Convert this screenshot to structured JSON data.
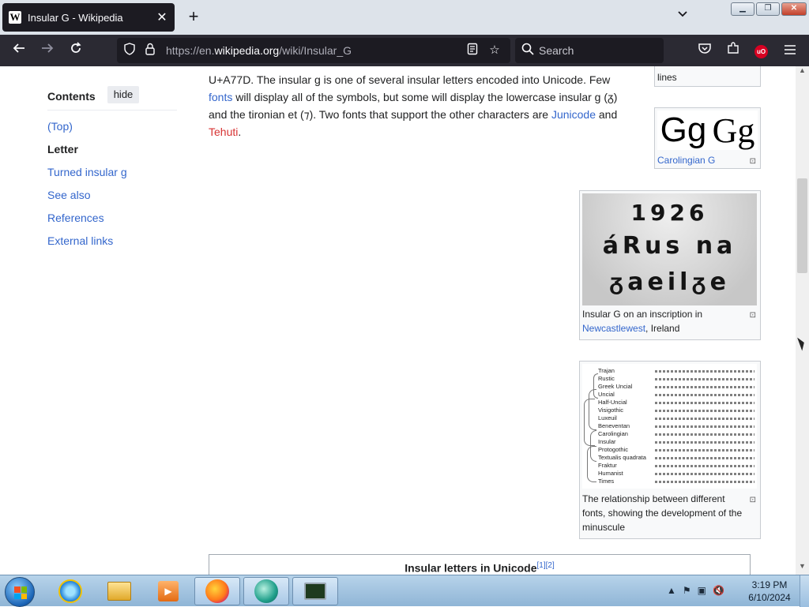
{
  "browser": {
    "tab_title": "Insular G - Wikipedia",
    "tab_favicon": "W",
    "tab_close": "✕",
    "new_tab": "+",
    "url_prefix": "https://en.",
    "url_domain": "wikipedia.org",
    "url_path": "/wiki/Insular_G",
    "search_placeholder": "Search",
    "extension_badge": "uO"
  },
  "toc": {
    "heading": "Contents",
    "hide_label": "hide",
    "items": [
      "(Top)",
      "Letter",
      "Turned insular g",
      "See also",
      "References",
      "External links"
    ]
  },
  "article": {
    "p1": "U+A77D. The insular g is one of several insular letters encoded into Unicode. Few ",
    "link_fonts": "fonts",
    "p2": " will display all of the symbols, but some will display the lowercase insular g (ᵹ) and the tironian et (⁊). Two fonts that support the other characters are ",
    "link_junicode": "Junicode",
    "p3": " and ",
    "link_tehuti": "Tehuti",
    "p4": "."
  },
  "figures": {
    "top_caption": "lines",
    "carolingian_sample": [
      "Gg",
      "Gg"
    ],
    "carolingian_caption": "Carolingian G",
    "inscription_lines": [
      "1926",
      "áRus na",
      "ᵹaeilᵹe"
    ],
    "inscription_caption_1": "Insular G on an inscription in ",
    "inscription_caption_link": "Newcastlewest",
    "inscription_caption_2": ", Ireland",
    "evolution_labels": [
      "Trajan",
      "Rustic",
      "Greek Uncial",
      "Uncial",
      "Half-Uncial",
      "Visigothic",
      "Luxeuil",
      "Beneventan",
      "Carolingian",
      "Insular",
      "Protogothic",
      "Textualis quadrata",
      "Fraktur",
      "Humanist",
      "Times"
    ],
    "evolution_caption": "The relationship between different fonts, showing the development of the minuscule",
    "enlarge_icon": "⊡"
  },
  "table": {
    "title": "Insular letters in Unicode",
    "refs": "[1][2]"
  },
  "taskbar": {
    "time": "3:19 PM",
    "date": "6/10/2024"
  }
}
